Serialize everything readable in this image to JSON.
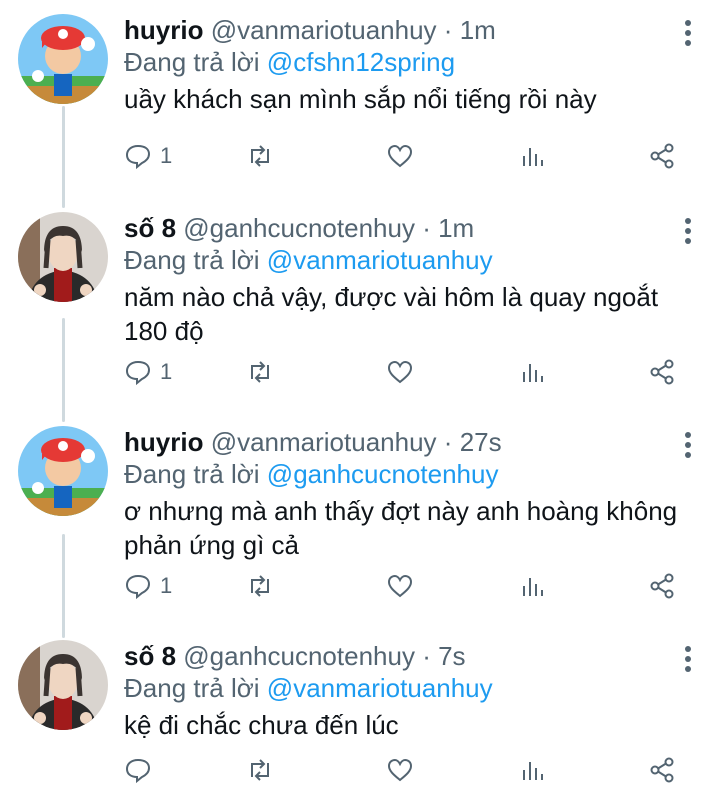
{
  "reply_prefix": "Đang trả lời",
  "tweets": [
    {
      "name": "huyrio",
      "handle": "@vanmariotuanhuy",
      "sep": "·",
      "time": "1m",
      "reply_to": "@cfshn12spring",
      "text": "uầy khách sạn mình sắp nổi tiếng rồi này",
      "replies": "1",
      "avatar": "mario"
    },
    {
      "name": "số 8",
      "handle": "@ganhcucnotenhuy",
      "sep": "·",
      "time": "1m",
      "reply_to": "@vanmariotuanhuy",
      "text": "năm nào chả vậy, được vài hôm là quay ngoắt 180 độ",
      "replies": "1",
      "avatar": "dark-hair"
    },
    {
      "name": "huyrio",
      "handle": "@vanmariotuanhuy",
      "sep": "·",
      "time": "27s",
      "reply_to": "@ganhcucnotenhuy",
      "text": "ơ nhưng mà anh thấy đợt này anh hoàng không phản ứng gì cả",
      "replies": "1",
      "avatar": "mario"
    },
    {
      "name": "số 8",
      "handle": "@ganhcucnotenhuy",
      "sep": "·",
      "time": "7s",
      "reply_to": "@vanmariotuanhuy",
      "text": "kệ đi chắc chưa đến lúc",
      "replies": "",
      "avatar": "dark-hair"
    }
  ],
  "colors": {
    "accent": "#1d9bf0",
    "muted": "#536471",
    "thread_line": "#cfd9de"
  }
}
